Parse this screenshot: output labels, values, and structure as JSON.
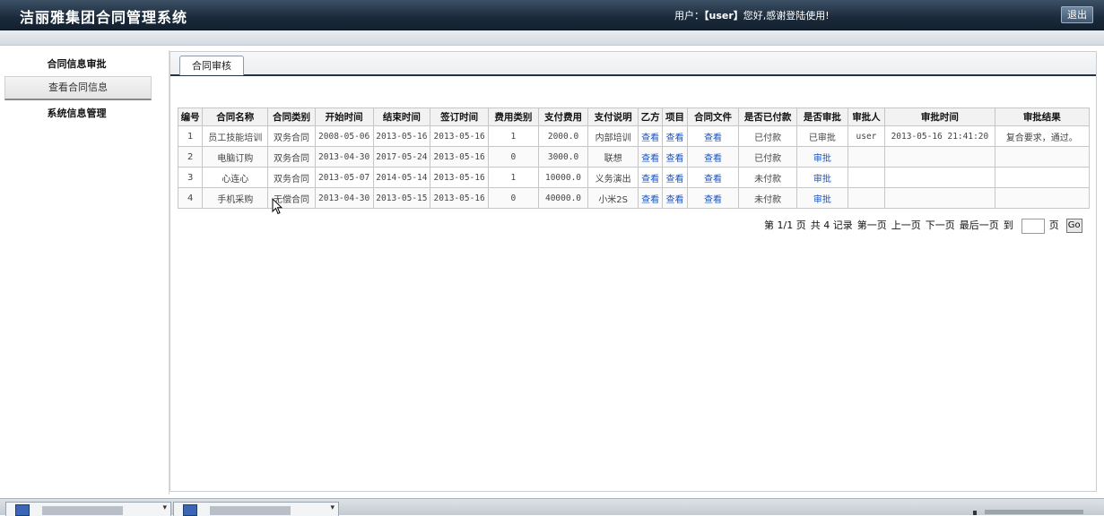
{
  "header": {
    "title": "洁丽雅集团合同管理系统",
    "user_prefix": "用户：",
    "user_name": "【user】",
    "welcome": "您好,感谢登陆使用!",
    "logout_label": "退出"
  },
  "sidebar": {
    "section1_title": "合同信息审批",
    "section1_item": "查看合同信息",
    "section2_title": "系统信息管理"
  },
  "tab": {
    "label": "合同审核"
  },
  "table": {
    "headers": [
      "编号",
      "合同名称",
      "合同类别",
      "开始时间",
      "结束时间",
      "签订时间",
      "费用类别",
      "支付费用",
      "支付说明",
      "乙方",
      "项目",
      "合同文件",
      "是否已付款",
      "是否审批",
      "审批人",
      "审批时间",
      "审批结果"
    ],
    "rows": [
      {
        "id": "1",
        "name": "员工技能培训",
        "type": "双务合同",
        "start": "2008-05-06",
        "end": "2013-05-16",
        "signed": "2013-05-16",
        "fee_type": "1",
        "fee": "2000.0",
        "fee_note": "内部培训",
        "party_b": "查看",
        "project": "查看",
        "file": "查看",
        "paid": "已付款",
        "approval": "已审批",
        "approver": "user",
        "approve_time": "2013-05-16 21:41:20",
        "result": "复合要求，通过。"
      },
      {
        "id": "2",
        "name": "电脑订购",
        "type": "双务合同",
        "start": "2013-04-30",
        "end": "2017-05-24",
        "signed": "2013-05-16",
        "fee_type": "0",
        "fee": "3000.0",
        "fee_note": "联想",
        "party_b": "查看",
        "project": "查看",
        "file": "查看",
        "paid": "已付款",
        "approval": "审批",
        "approver": "",
        "approve_time": "",
        "result": ""
      },
      {
        "id": "3",
        "name": "心连心",
        "type": "双务合同",
        "start": "2013-05-07",
        "end": "2014-05-14",
        "signed": "2013-05-16",
        "fee_type": "1",
        "fee": "10000.0",
        "fee_note": "义务演出",
        "party_b": "查看",
        "project": "查看",
        "file": "查看",
        "paid": "未付款",
        "approval": "审批",
        "approver": "",
        "approve_time": "",
        "result": ""
      },
      {
        "id": "4",
        "name": "手机采购",
        "type": "无偿合同",
        "start": "2013-04-30",
        "end": "2013-05-15",
        "signed": "2013-05-16",
        "fee_type": "0",
        "fee": "40000.0",
        "fee_note": "小米2S",
        "party_b": "查看",
        "project": "查看",
        "file": "查看",
        "paid": "未付款",
        "approval": "审批",
        "approver": "",
        "approve_time": "",
        "result": ""
      }
    ]
  },
  "pager": {
    "page_info": "第 1/1 页",
    "total": "共 4 记录",
    "first": "第一页",
    "prev": "上一页",
    "next": "下一页",
    "last": "最后一页",
    "goto": "到",
    "page_unit": "页",
    "go_label": "Go"
  }
}
